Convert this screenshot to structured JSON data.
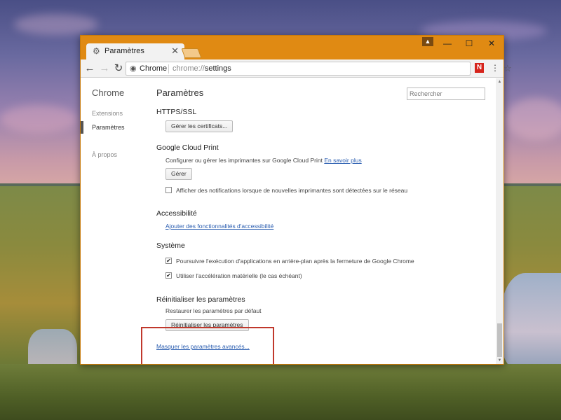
{
  "tab": {
    "title": "Paramètres",
    "icon": "gear-icon",
    "close_glyph": "✕"
  },
  "window_controls": {
    "minimize": "—",
    "maximize": "☐",
    "close": "✕"
  },
  "toolbar": {
    "omni_chip": "Chrome",
    "url_scheme": "chrome://",
    "url_path": "settings",
    "ext_label": "N"
  },
  "sidebar": {
    "title": "Chrome",
    "items": [
      {
        "label": "Extensions",
        "active": false
      },
      {
        "label": "Paramètres",
        "active": true
      },
      {
        "label": "À propos",
        "active": false
      }
    ]
  },
  "main": {
    "title": "Paramètres",
    "search_placeholder": "Rechercher",
    "https": {
      "heading": "HTTPS/SSL",
      "button": "Gérer les certificats..."
    },
    "cloud_print": {
      "heading": "Google Cloud Print",
      "description": "Configurer ou gérer les imprimantes sur Google Cloud Print",
      "link": "En savoir plus",
      "button": "Gérer",
      "checkbox_label": "Afficher des notifications lorsque de nouvelles imprimantes sont détectées sur le réseau",
      "checkbox_checked": false
    },
    "accessibility": {
      "heading": "Accessibilité",
      "link": "Ajouter des fonctionnalités d'accessibilité"
    },
    "system": {
      "heading": "Système",
      "options": [
        {
          "label": "Poursuivre l'exécution d'applications en arrière-plan après la fermeture de Google Chrome",
          "checked": true
        },
        {
          "label": "Utiliser l'accélération matérielle (le cas échéant)",
          "checked": true
        }
      ]
    },
    "reset": {
      "heading": "Réinitialiser les paramètres",
      "description": "Restaurer les paramètres par défaut",
      "button": "Réinitialiser les paramètres"
    },
    "hide_advanced_link": "Masquer les paramètres avancés..."
  },
  "colors": {
    "titlebar": "#e08a13",
    "highlight_box": "#c0382c",
    "link": "#2a5db0"
  }
}
